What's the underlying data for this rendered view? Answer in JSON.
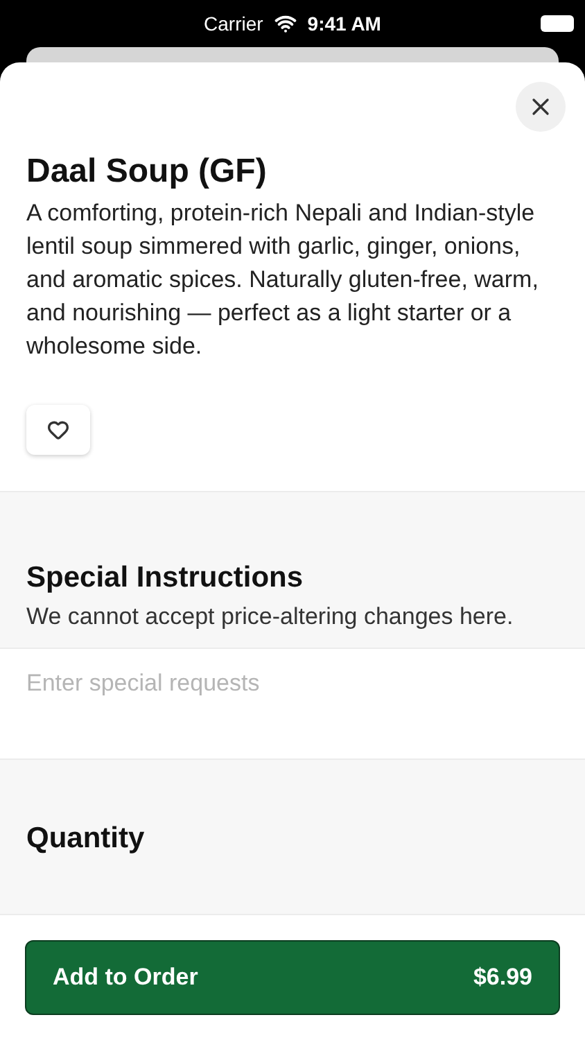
{
  "status_bar": {
    "carrier": "Carrier",
    "time": "9:41 AM"
  },
  "item": {
    "title": "Daal Soup (GF)",
    "description": "A comforting, protein-rich Nepali and Indian-style lentil soup simmered with garlic, ginger, onions, and aromatic spices. Naturally gluten-free, warm, and nourishing — perfect as a light starter or a wholesome side.",
    "favorited": false
  },
  "special_instructions": {
    "title": "Special Instructions",
    "note": "We cannot accept price-altering changes here.",
    "placeholder": "Enter special requests"
  },
  "quantity": {
    "title": "Quantity"
  },
  "add_button": {
    "label": "Add to Order",
    "price": "$6.99"
  }
}
